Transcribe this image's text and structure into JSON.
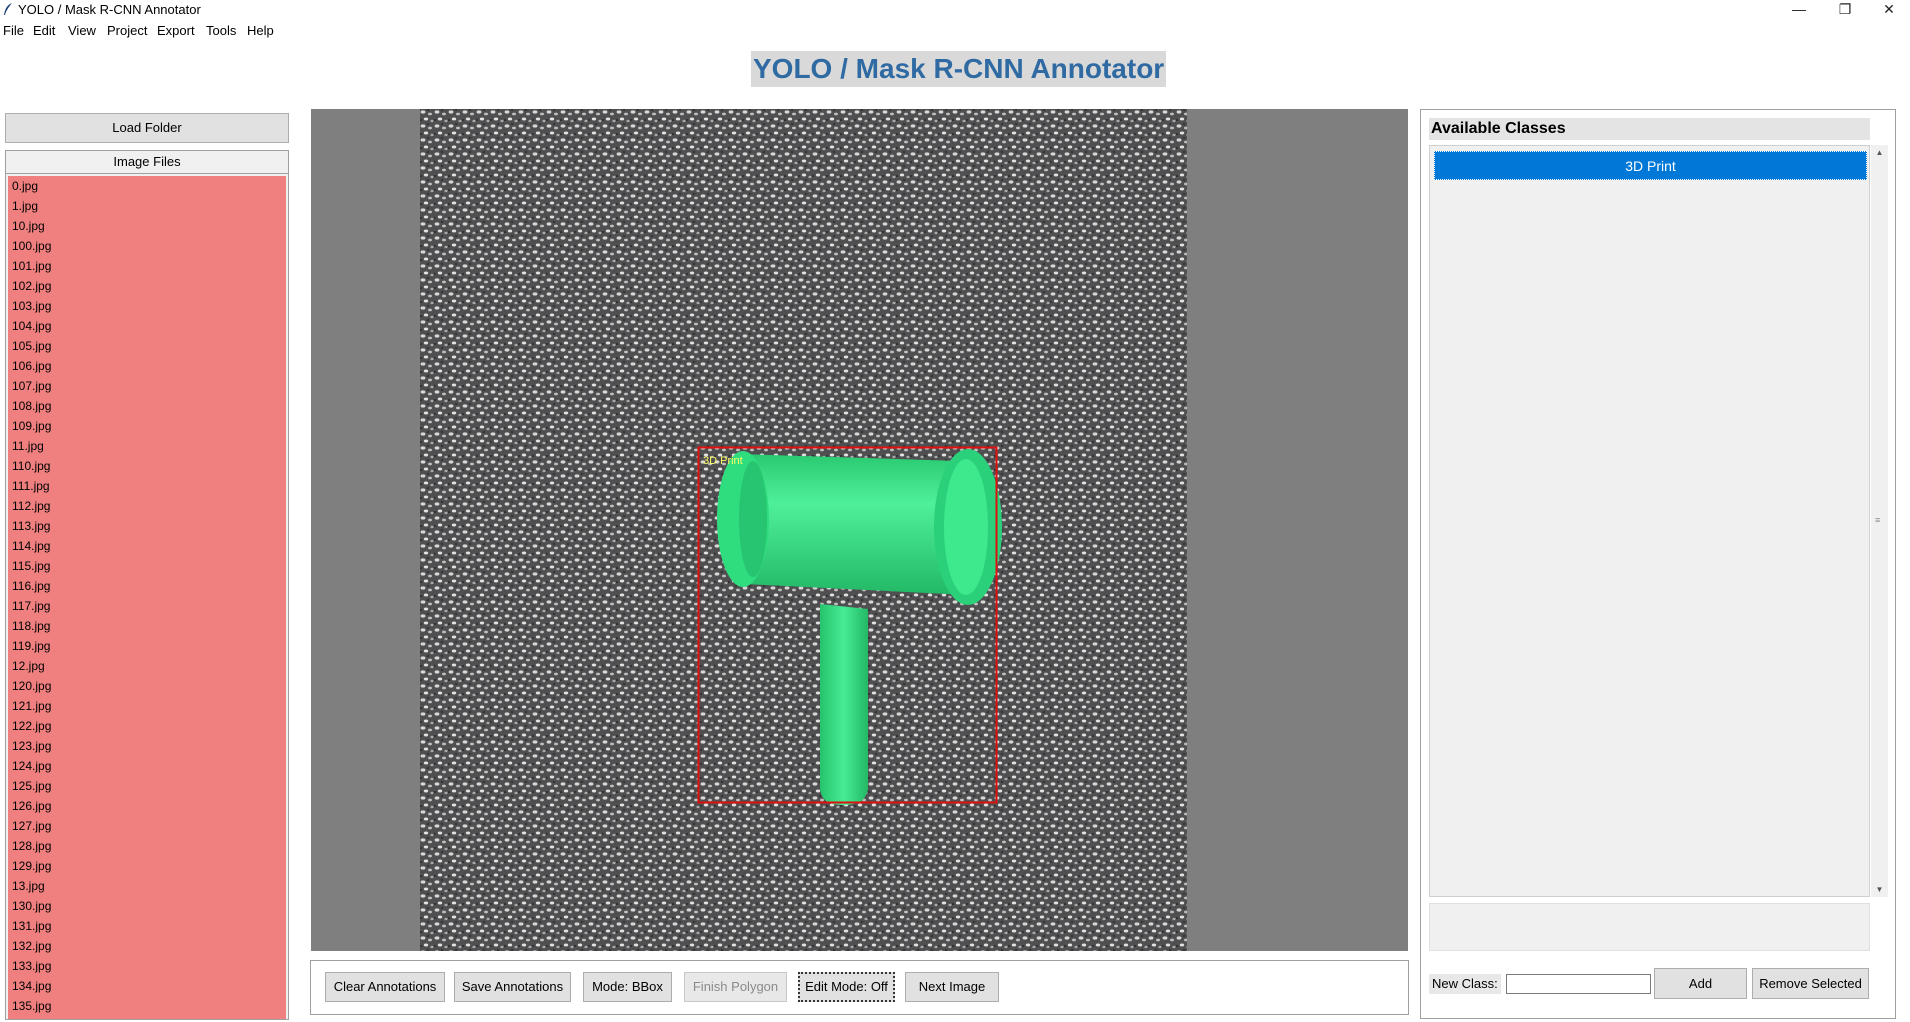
{
  "window": {
    "title": "YOLO / Mask R-CNN Annotator"
  },
  "menu": [
    "File",
    "Edit",
    "View",
    "Project",
    "Export",
    "Tools",
    "Help"
  ],
  "app_title": "YOLO / Mask R-CNN Annotator",
  "left": {
    "load_folder": "Load Folder",
    "files_header": "Image Files",
    "files": [
      "0.jpg",
      "1.jpg",
      "10.jpg",
      "100.jpg",
      "101.jpg",
      "102.jpg",
      "103.jpg",
      "104.jpg",
      "105.jpg",
      "106.jpg",
      "107.jpg",
      "108.jpg",
      "109.jpg",
      "11.jpg",
      "110.jpg",
      "111.jpg",
      "112.jpg",
      "113.jpg",
      "114.jpg",
      "115.jpg",
      "116.jpg",
      "117.jpg",
      "118.jpg",
      "119.jpg",
      "12.jpg",
      "120.jpg",
      "121.jpg",
      "122.jpg",
      "123.jpg",
      "124.jpg",
      "125.jpg",
      "126.jpg",
      "127.jpg",
      "128.jpg",
      "129.jpg",
      "13.jpg",
      "130.jpg",
      "131.jpg",
      "132.jpg",
      "133.jpg",
      "134.jpg",
      "135.jpg"
    ]
  },
  "canvas": {
    "annotation_label": "3D Print",
    "bbox_color": "#e01010",
    "label_color": "#ffff66",
    "object_color": "#2ee07f"
  },
  "toolbar": {
    "clear": "Clear Annotations",
    "save": "Save Annotations",
    "mode": "Mode: BBox",
    "finish": "Finish Polygon",
    "edit": "Edit Mode: Off",
    "next": "Next Image"
  },
  "classes": {
    "header": "Available Classes",
    "items": [
      "3D Print"
    ],
    "new_class_label": "New Class:",
    "new_class_value": "",
    "add": "Add",
    "remove": "Remove Selected"
  },
  "colors": {
    "file_list_bg": "#f08080",
    "selected_class": "#0078d7",
    "title_text": "#2f6aa3"
  }
}
